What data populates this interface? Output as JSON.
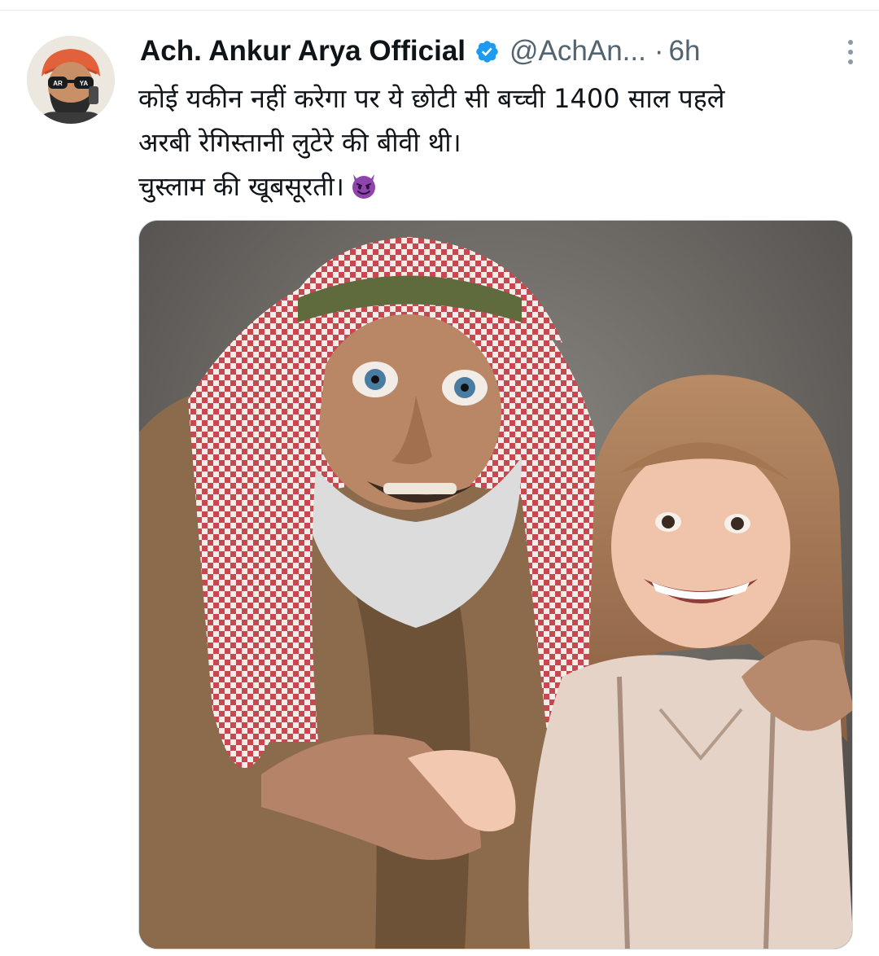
{
  "tweet": {
    "display_name": "Ach. Ankur Arya Official",
    "handle": "@AchAn...",
    "separator": "·",
    "time": "6h",
    "avatar_text": "AR YA",
    "text_lines": [
      "कोई यकीन नहीं करेगा पर ये छोटी सी बच्ची 1400 साल पहले",
      "अरबी रेगिस्तानी लुटेरे की बीवी थी।",
      "चुस्लाम की खूबसूरती।"
    ],
    "emoji": "smiling-face-with-horns",
    "verified": true,
    "media": {
      "kind": "photo",
      "description_icon": "photo-old-man-and-girl"
    }
  },
  "colors": {
    "verified_blue": "#1d9bf0",
    "secondary_text": "#536471",
    "primary_text": "#0f1419",
    "emoji_purple": "#8e44ad"
  }
}
